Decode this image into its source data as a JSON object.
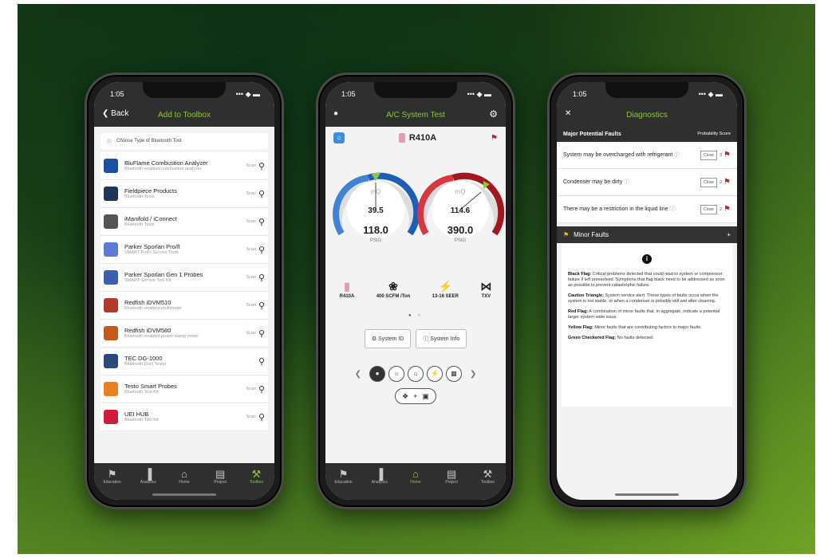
{
  "phone1": {
    "status_time": "1:05",
    "status_icons": "••• ◆ ▬",
    "back_label": "Back",
    "title": "Add to Toolbox",
    "choose_label": "Choose Type of Bluetooth Tool",
    "tools": [
      {
        "name": "BluFlame Combustion Analyzer",
        "desc": "Bluetooth-enabled combustion analyzer",
        "scan": "Scan",
        "color": "#1b4fa0"
      },
      {
        "name": "Fieldpiece Products",
        "desc": "Bluetooth Tools",
        "scan": "Scan",
        "color": "#1d3557"
      },
      {
        "name": "iManifold / iConnect",
        "desc": "Bluetooth Tools",
        "scan": "Scan",
        "color": "#555555"
      },
      {
        "name": "Parker Sporlan Pro/fl",
        "desc": "SMART ProFl Service Tools",
        "scan": "Scan",
        "color": "#5a7bd6"
      },
      {
        "name": "Parker Sporlan Gen 1 Probes",
        "desc": "SMART Service Tool Kit",
        "scan": "Scan",
        "color": "#3a5fb0"
      },
      {
        "name": "Redfish iDVM510",
        "desc": "Bluetooth-enabled multimeter",
        "scan": "Scan",
        "color": "#b23a2a"
      },
      {
        "name": "Redfish iDVM580",
        "desc": "Bluetooth-enabled power clamp meter",
        "scan": "Scan",
        "color": "#c45a1a"
      },
      {
        "name": "TEC DG-1000",
        "desc": "Bluetooth Duct Tester",
        "scan": "",
        "color": "#2a4b7a"
      },
      {
        "name": "Testo Smart Probes",
        "desc": "Bluetooth Tool Kit",
        "scan": "Scan",
        "color": "#e8821e"
      },
      {
        "name": "UEI HUB",
        "desc": "Bluetooth Tool Kit",
        "scan": "Scan",
        "color": "#d11b3b"
      }
    ],
    "tabs": [
      {
        "label": "Education",
        "icon": "⚑"
      },
      {
        "label": "Analytics",
        "icon": "▐"
      },
      {
        "label": "Home",
        "icon": "⌂"
      },
      {
        "label": "Project",
        "icon": "▤"
      },
      {
        "label": "Toolbox",
        "icon": "⚒"
      }
    ]
  },
  "phone2": {
    "status_time": "1:05",
    "status_icons": "••• ◆ ▬",
    "title": "A/C System Test",
    "refrigerant": "R410A",
    "left_gauge": {
      "unit_label": "mQ",
      "inner_value": "39.5",
      "main_value": "118.0",
      "unit": "PSIG"
    },
    "right_gauge": {
      "unit_label": "mQ",
      "inner_value": "114.6",
      "main_value": "390.0",
      "unit": "PSIG"
    },
    "specs": [
      {
        "icon": "▮",
        "label": "R410A"
      },
      {
        "icon": "❀",
        "label": "400 SCFM /Ton"
      },
      {
        "icon": "⚡",
        "label": "13-16 SEER"
      },
      {
        "icon": "⋈",
        "label": "TXV"
      }
    ],
    "page_dots": "● ○",
    "system_id_label": "System ID",
    "system_info_label": "System Info",
    "tabs": [
      {
        "label": "Education",
        "icon": "⚑"
      },
      {
        "label": "Analytics",
        "icon": "▐"
      },
      {
        "label": "Home",
        "icon": "⌂"
      },
      {
        "label": "Project",
        "icon": "▤"
      },
      {
        "label": "Toolbox",
        "icon": "⚒"
      }
    ]
  },
  "phone3": {
    "status_time": "1:05",
    "status_icons": "••• ◆ ▬",
    "title": "Diagnostics",
    "major_header": "Major Potential Faults",
    "probability_header": "Probability Score",
    "faults": [
      {
        "text": "System may be overcharged with refrigerant",
        "close": "Close",
        "score": "3"
      },
      {
        "text": "Condenser may be dirty",
        "close": "Close",
        "score": "2"
      },
      {
        "text": "There may be a restriction in the liquid line",
        "close": "Close",
        "score": "2"
      }
    ],
    "minor_header": "Minor Faults",
    "legend": [
      {
        "title": "Black Flag:",
        "text": "Critical problems detected that could lead to system or compressor failure if left unresolved. Symptoms that flag black need to be addressed as soon as possible to prevent catastrophic failure."
      },
      {
        "title": "Caution Triangle:",
        "text": "System service alert. These types of faults occur when the system is not stable, or when a condenser is possibly still wet after cleaning."
      },
      {
        "title": "Red Flag:",
        "text": "A combination of minor faults that, in aggregate, indicate a potential larger system-wide issue"
      },
      {
        "title": "Yellow Flag:",
        "text": "Minor faults that are contributing factors to major faults."
      },
      {
        "title": "Green Checkered Flag:",
        "text": "No faults detected."
      }
    ]
  }
}
